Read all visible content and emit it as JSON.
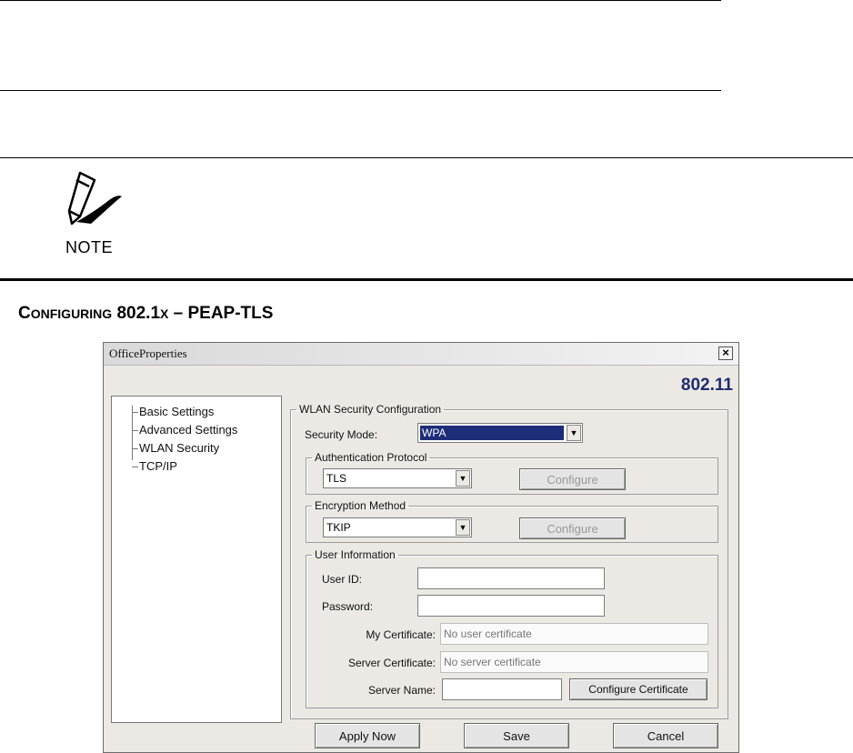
{
  "note": {
    "label": "NOTE"
  },
  "section": {
    "title_cap": "C",
    "title_small": "ONFIGURING",
    "title_rest": " 802.1",
    "title_x": "X",
    "title_end": " – PEAP-TLS"
  },
  "window": {
    "title": "OfficeProperties",
    "close_label": "×",
    "brand": "802.11",
    "tree": [
      "Basic Settings",
      "Advanced Settings",
      "WLAN Security",
      "TCP/IP"
    ],
    "security_group": "WLAN Security Configuration",
    "security_mode_label": "Security Mode:",
    "security_mode_value": "WPA",
    "auth_group": "Authentication Protocol",
    "auth_value": "TLS",
    "configure_label": "Configure",
    "enc_group": "Encryption Method",
    "enc_value": "TKIP",
    "user_group": "User Information",
    "user_id_label": "User ID:",
    "password_label": "Password:",
    "my_cert_label": "My Certificate:",
    "my_cert_placeholder": "No user certificate",
    "server_cert_label": "Server Certificate:",
    "server_cert_placeholder": "No server certificate",
    "server_name_label": "Server Name:",
    "configure_cert_label": "Configure Certificate",
    "apply_label": "Apply Now",
    "save_label": "Save",
    "cancel_label": "Cancel"
  }
}
